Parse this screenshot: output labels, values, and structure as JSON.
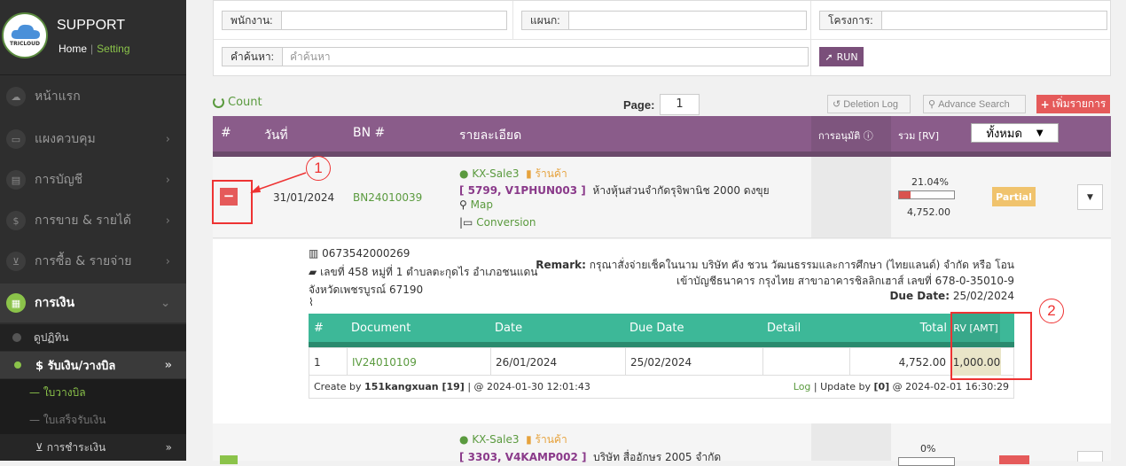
{
  "brand": {
    "title": "SUPPORT",
    "logo_text": "TRICLOUD",
    "home": "Home",
    "setting": "Setting"
  },
  "nav": [
    {
      "label": "หน้าแรก",
      "icon": "cloud-icon"
    },
    {
      "label": "แผงควบคุม",
      "icon": "monitor-icon"
    },
    {
      "label": "การบัญชี",
      "icon": "book-icon"
    },
    {
      "label": "การขาย & รายได้",
      "icon": "dollar-icon"
    },
    {
      "label": "การซื้อ & รายจ่าย",
      "icon": "cart-icon"
    },
    {
      "label": "การเงิน",
      "icon": "calendar-icon"
    }
  ],
  "subnav": {
    "item1": "ดูปฏิทิน",
    "item2": "$ รับเงิน/วางบิล",
    "item3": "— ใบวางบิล",
    "item4": "— ใบเสร็จรับเงิน",
    "item5": "การชำระเงิน"
  },
  "filter": {
    "employee_label": "พนักงาน:",
    "dept_label": "แผนก:",
    "project_label": "โครงการ:",
    "search_label": "คำค้นหา:",
    "search_placeholder": "คำค้นหา",
    "run": "RUN"
  },
  "toolbar": {
    "count": "Count",
    "page_label": "Page:",
    "page": "1",
    "deletion_log": "Deletion Log",
    "advance_search": "Advance Search",
    "add": "เพิ่มรายการ"
  },
  "table_head": {
    "c1": "#",
    "c2": "วันที่",
    "c3": "BN #",
    "c4": "รายละเอียด",
    "c5": "การอนุมัติ",
    "c6": "รวม [RV]",
    "select": "ทั้งหมด"
  },
  "row1": {
    "date": "31/01/2024",
    "bn": "BN24010039",
    "user": "KX-Sale3",
    "shop": "ร้านค้า",
    "code": "[ 5799, V1PHUN003 ]",
    "company": "ห้างหุ้นส่วนจำกัดรุจิพานิช 2000 ดงขุย",
    "map": "Map",
    "conversion": "Conversion",
    "pct": "21.04%",
    "pct_value": 0.2104,
    "amount": "4,752.00",
    "status": "Partial"
  },
  "detail": {
    "barcode": "0673542000269",
    "address1": "เลขที่ 458 หมู่ที่ 1 ตำบลตะกุดไร อำเภอชนแดน",
    "address2": "จังหวัดเพชรบูรณ์ 67190",
    "remark_label": "Remark:",
    "remark1": "กรุณาสั่งจ่ายเช็คในนาม บริษัท คัง ชวน วัฒนธรรมและการศึกษา (ไทยแลนด์) จำกัด หรือ โอน",
    "remark2": "เข้าบัญชีธนาคาร กรุงไทย สาขาอาคารชิลลิกเฮาส์ เลขที่ 678-0-35010-9",
    "due_label": "Due Date:",
    "due": "25/02/2024"
  },
  "subtable": {
    "h1": "#",
    "h2": "Document",
    "h3": "Date",
    "h4": "Due Date",
    "h5": "Detail",
    "h6": "Total",
    "h7": "RV [AMT]",
    "r_no": "1",
    "r_doc": "IV24010109",
    "r_date": "26/01/2024",
    "r_due": "25/02/2024",
    "r_detail": "",
    "r_total": "4,752.00",
    "r_rv": "1,000.00",
    "create_by": "Create by",
    "creator": "151kangxuan [19]",
    "create_at": "| @ 2024-01-30 12:01:43",
    "log": "Log",
    "update_by": "| Update by",
    "updater": "[0]",
    "update_at": "@ 2024-02-01 16:30:29"
  },
  "row2": {
    "user": "KX-Sale3",
    "shop": "ร้านค้า",
    "code": "[ 3303, V4KAMP002 ]",
    "company": "บริษัท สื่ออักษร 2005 จำกัด",
    "pct": "0%"
  },
  "annotations": {
    "a1": "1",
    "a2": "2"
  }
}
